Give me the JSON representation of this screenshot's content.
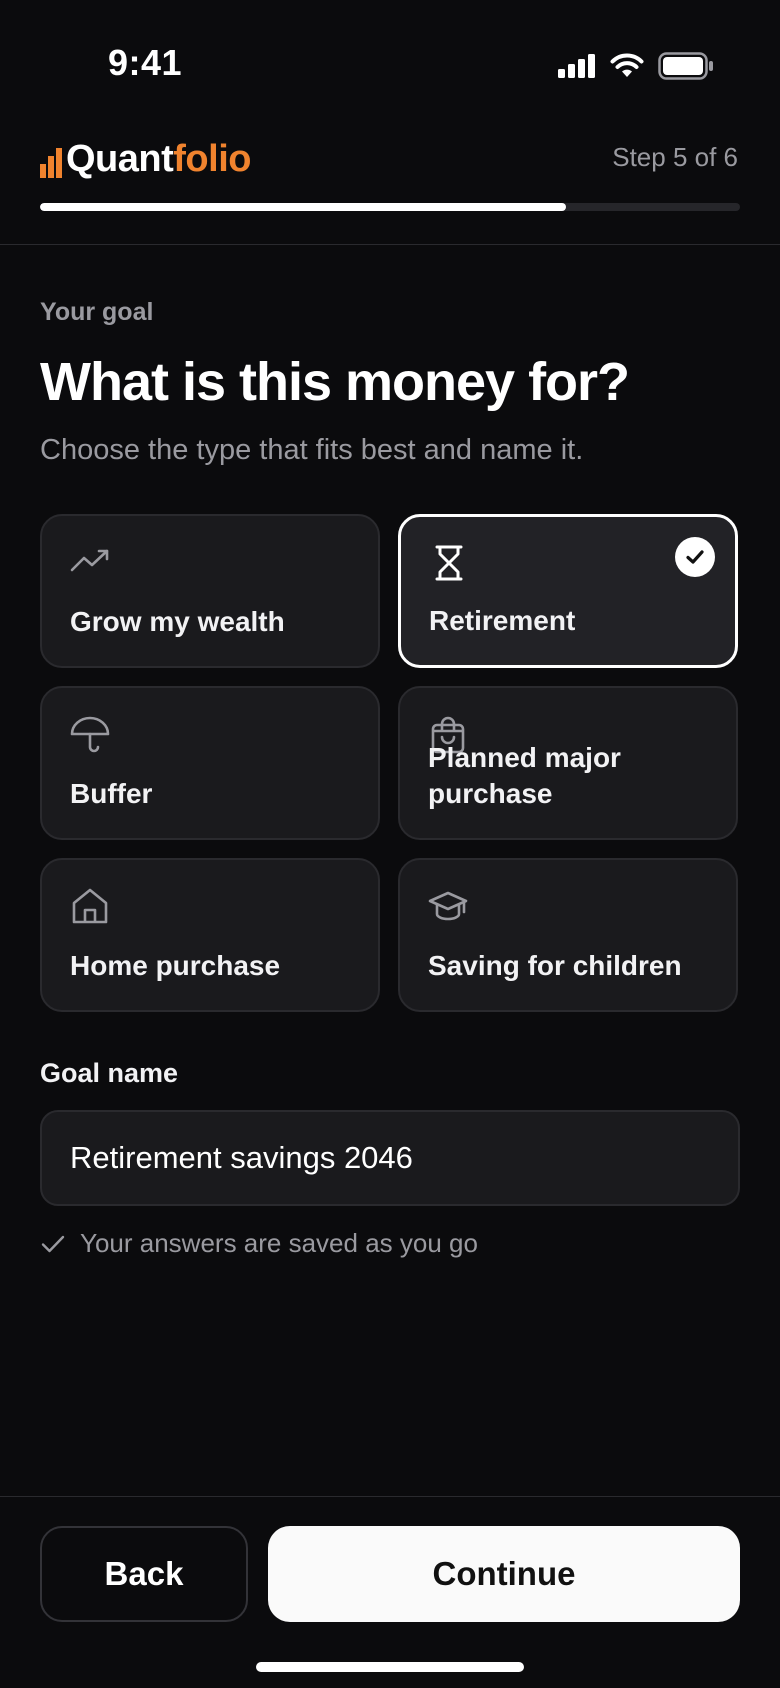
{
  "status_bar": {
    "time": "9:41",
    "icons": [
      "signal-icon",
      "wifi-icon",
      "battery-icon"
    ]
  },
  "header": {
    "logo": {
      "prefix": "Quant",
      "suffix": "folio",
      "accent_color": "#f0832e"
    },
    "step_text": "Step 5 of 6",
    "progress_fraction": 0.752
  },
  "intro": {
    "eyebrow": "Your goal",
    "title": "What is this money for?",
    "subtitle": "Choose the type that fits best and name it."
  },
  "goal_types": [
    {
      "label": "Grow my wealth",
      "icon": "trending-up-icon",
      "selected": false
    },
    {
      "label": "Retirement",
      "icon": "hourglass-icon",
      "selected": true
    },
    {
      "label": "Buffer",
      "icon": "umbrella-icon",
      "selected": false
    },
    {
      "label": "Planned major purchase",
      "icon": "shopping-bag-icon",
      "selected": false
    },
    {
      "label": "Home purchase",
      "icon": "home-icon",
      "selected": false
    },
    {
      "label": "Saving for children",
      "icon": "graduation-cap-icon",
      "selected": false
    }
  ],
  "goal_name": {
    "label": "Goal name",
    "value": "Retirement savings 2046"
  },
  "saved_note": "Your answers are saved as you go",
  "footer": {
    "back_label": "Back",
    "continue_label": "Continue"
  }
}
